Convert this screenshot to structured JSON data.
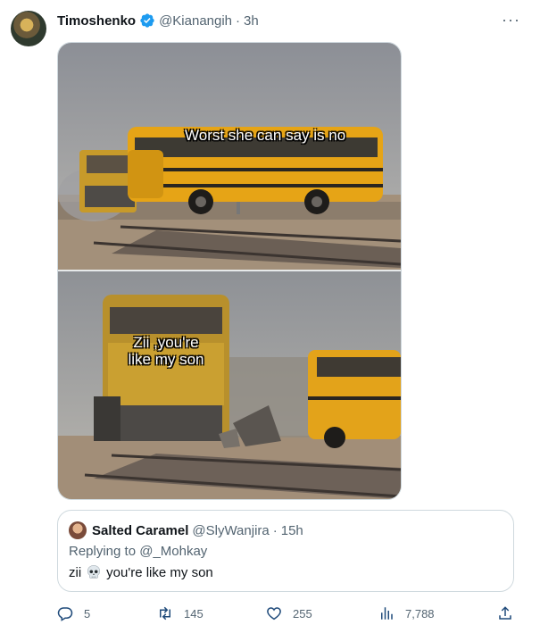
{
  "tweet": {
    "author_name": "Timoshenko",
    "handle": "@Kianangih",
    "separator": "·",
    "time": "3h",
    "more_label": "···"
  },
  "media": {
    "top_caption": "Worst she can say is no",
    "bottom_caption": "Zii ,you're\nlike my son"
  },
  "quoted": {
    "author_name": "Salted Caramel",
    "handle": "@SlyWanjira",
    "separator": "·",
    "time": "15h",
    "replying": "Replying to @_Mohkay",
    "text_before": "zii",
    "text_after": "you're like my son"
  },
  "actions": {
    "replies": "5",
    "retweets": "145",
    "likes": "255",
    "views": "7,788"
  },
  "colors": {
    "text": "#0f1419",
    "secondary": "#536471",
    "verified": "#1d9bf0",
    "border": "#cfd9de"
  }
}
